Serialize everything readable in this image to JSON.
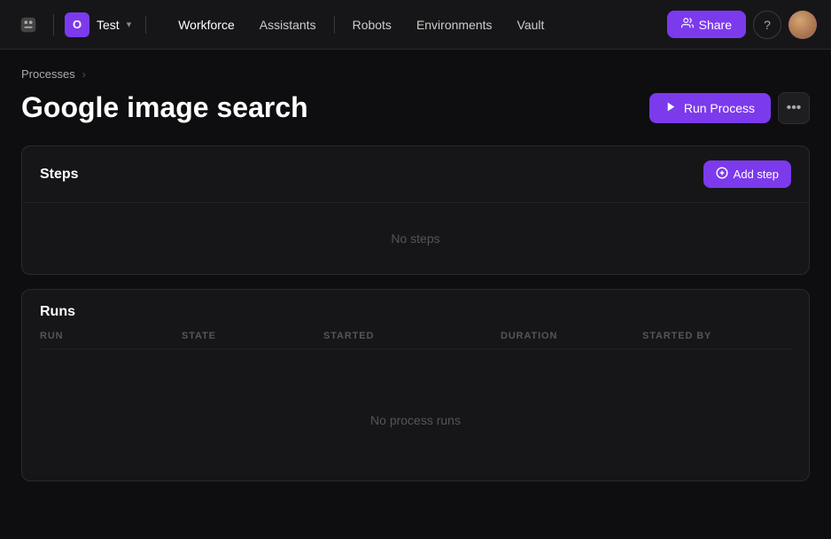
{
  "navbar": {
    "logo_symbol": "🤖",
    "workspace_initial": "O",
    "workspace_name": "Test",
    "chevron": "▾",
    "nav_items": [
      {
        "label": "Workforce",
        "active": true
      },
      {
        "label": "Assistants",
        "active": false
      },
      {
        "label": "Robots",
        "active": false
      },
      {
        "label": "Environments",
        "active": false
      },
      {
        "label": "Vault",
        "active": false
      }
    ],
    "share_label": "Share",
    "share_icon": "👥",
    "help_icon": "?",
    "user_icon": "user"
  },
  "breadcrumb": {
    "parent_label": "Processes",
    "separator": "›"
  },
  "page": {
    "title": "Google image search",
    "run_process_label": "Run Process",
    "more_icon": "•••"
  },
  "steps_card": {
    "title": "Steps",
    "add_step_label": "Add step",
    "add_icon": "⊕",
    "empty_label": "No steps"
  },
  "runs_card": {
    "title": "Runs",
    "columns": [
      "RUN",
      "STATE",
      "STARTED",
      "DURATION",
      "STARTED BY"
    ],
    "empty_label": "No process runs"
  }
}
